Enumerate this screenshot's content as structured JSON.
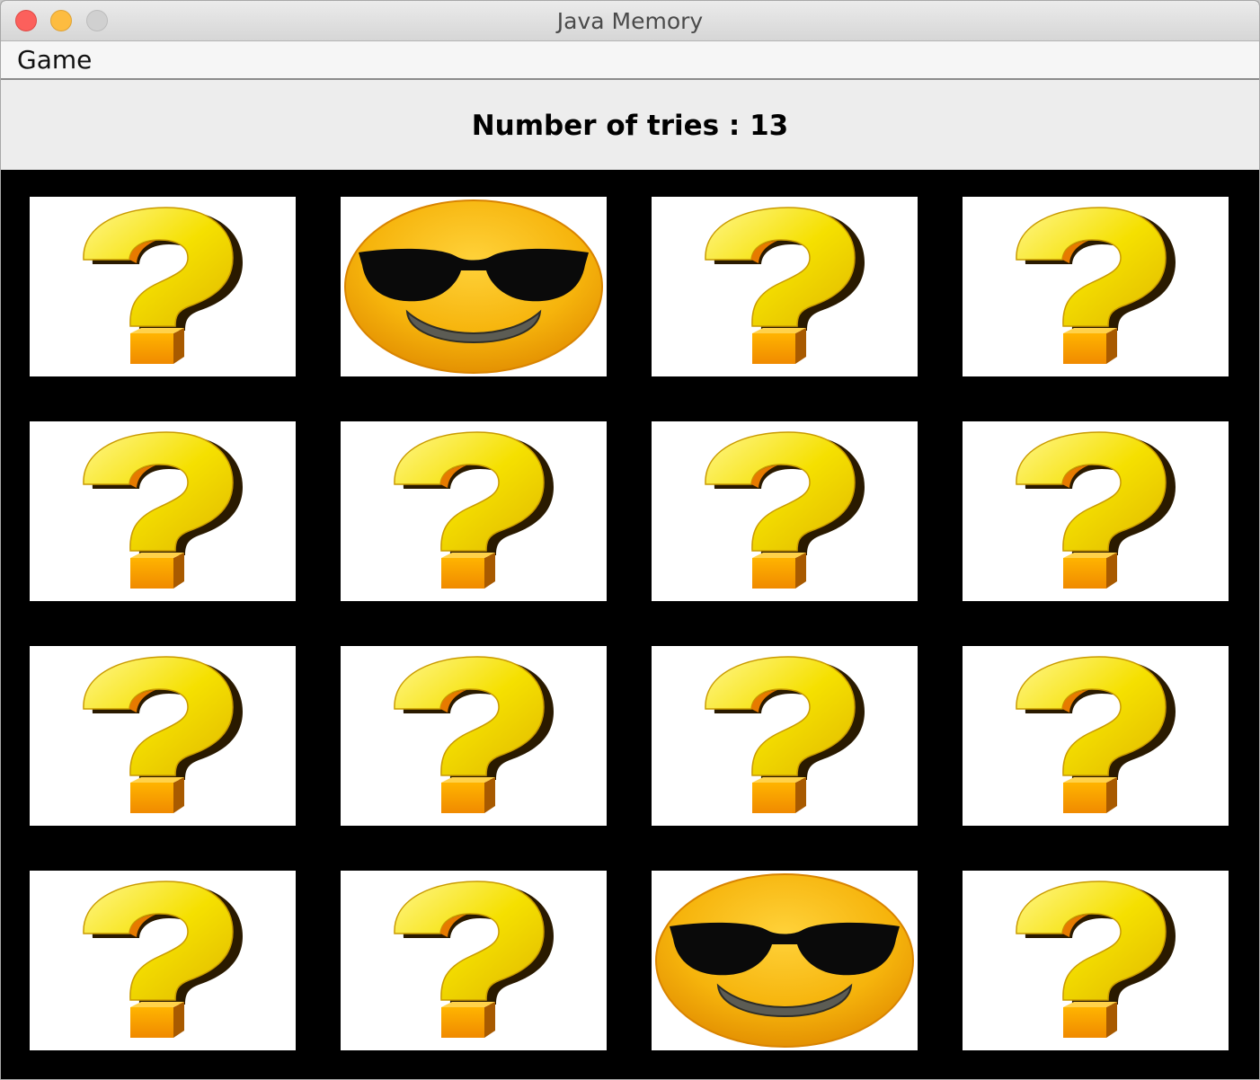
{
  "window": {
    "title": "Java Memory"
  },
  "menu": {
    "items": [
      "Game"
    ]
  },
  "status": {
    "tries_text": "Number of tries : 13",
    "tries": 13
  },
  "board": {
    "rows": 4,
    "cols": 4,
    "cards": [
      "question",
      "smiley-sunglasses",
      "question",
      "question",
      "question",
      "question",
      "question",
      "question",
      "question",
      "question",
      "question",
      "question",
      "question",
      "question",
      "smiley-sunglasses",
      "question"
    ]
  },
  "colors": {
    "board_bg": "#000000",
    "card_bg": "#ffffff",
    "question_yellow": "#f5e000",
    "smiley_orange": "#f3a60a"
  }
}
